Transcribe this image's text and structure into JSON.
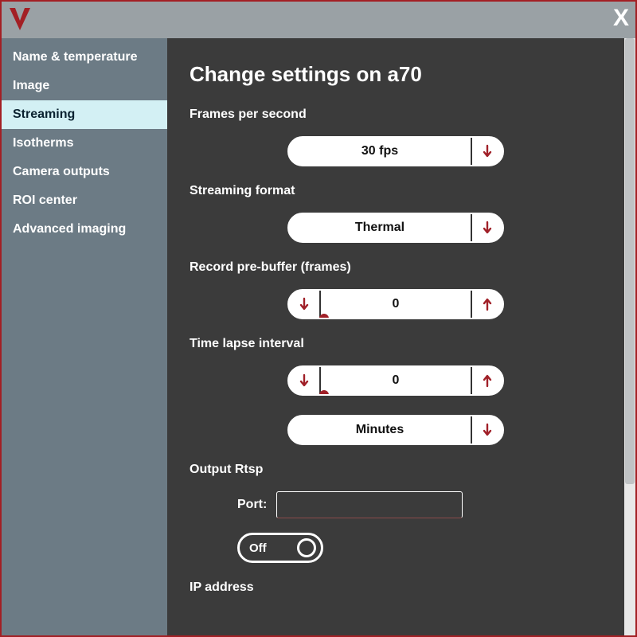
{
  "sidebar": {
    "items": [
      {
        "label": "Name & temperature"
      },
      {
        "label": "Image"
      },
      {
        "label": "Streaming"
      },
      {
        "label": "Isotherms"
      },
      {
        "label": "Camera outputs"
      },
      {
        "label": "ROI center"
      },
      {
        "label": "Advanced imaging"
      }
    ],
    "active_index": 2
  },
  "main": {
    "title": "Change settings on a70",
    "fps": {
      "label": "Frames per second",
      "value": "30 fps"
    },
    "format": {
      "label": "Streaming format",
      "value": "Thermal"
    },
    "prebuffer": {
      "label": "Record pre-buffer (frames)",
      "value": "0"
    },
    "timelapse": {
      "label": "Time lapse interval",
      "value": "0",
      "unit": "Minutes"
    },
    "rtsp": {
      "label": "Output Rtsp",
      "port_label": "Port:",
      "port_value": "",
      "toggle": "Off"
    },
    "ip": {
      "label": "IP address"
    }
  }
}
